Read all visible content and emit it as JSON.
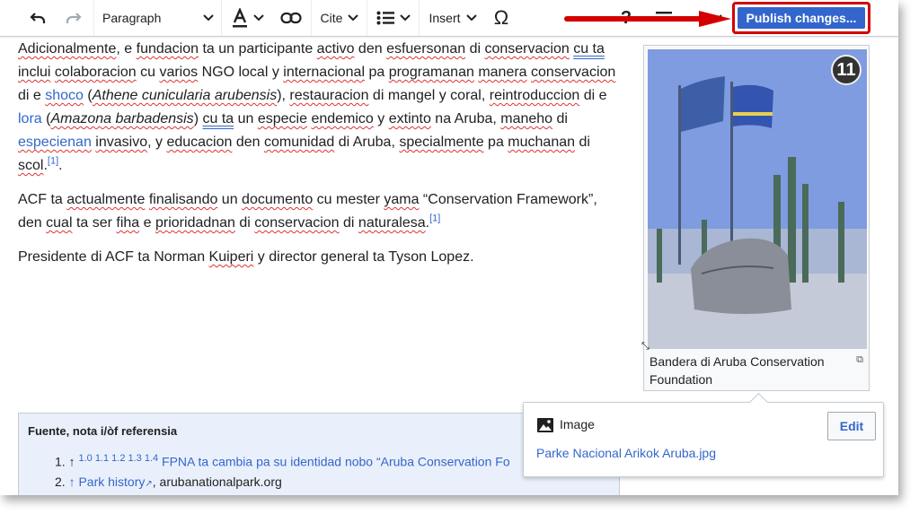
{
  "toolbar": {
    "paragraph_label": "Paragraph",
    "cite_label": "Cite",
    "insert_label": "Insert",
    "publish_label": "Publish changes..."
  },
  "article": {
    "p1": {
      "t1": "Adicionalmente",
      "t2": ", e ",
      "t3": "fundacion",
      "t4": " ta un participante ",
      "t5": "activo",
      "t6": " den ",
      "t7": "esfuersonan",
      "t8": " di ",
      "t9": "conservacion",
      "t10": " ",
      "t11": "cu ta",
      "t12": " ",
      "t13": "inclui",
      "t14": " ",
      "t15": "colaboracion",
      "t16": " cu ",
      "t17": "varios",
      "t18": " NGO local y ",
      "t19": "internacional",
      "t20": " pa ",
      "t21": "programanan",
      "t22": " ",
      "t23": "manera",
      "t24": " ",
      "t25": "conservacion",
      "t26": " di e ",
      "t27": "shoco",
      "t28": " (",
      "t29": "Athene cunicularia arubensis",
      "t30": "), ",
      "t31": "restauracion",
      "t32": " di mangel y coral, ",
      "t33": "reintroduccion",
      "t34": " di e ",
      "t35": "lora",
      "t36": " (",
      "t37": "Amazona barbadensis",
      "t38": ") ",
      "t39": "cu ta",
      "t40": " un ",
      "t41": "especie",
      "t42": " ",
      "t43": "endemico",
      "t44": " y ",
      "t45": "extinto",
      "t46": " na Aruba, ",
      "t47": "maneho",
      "t48": " di ",
      "t49": "especienan",
      "t50": " ",
      "t51": "invasivo",
      "t52": ", y ",
      "t53": "educacion",
      "t54": " den ",
      "t55": "comunidad",
      "t56": " di Aruba, ",
      "t57": "specialmente",
      "t58": " pa ",
      "t59": "muchanan",
      "t60": " di ",
      "t61": "scol",
      "t62": ".",
      "ref": "[1]",
      "t63": "."
    },
    "p2": {
      "t1": "ACF ta ",
      "t2": "actualmente",
      "t3": " ",
      "t4": "finalisando",
      "t5": " un ",
      "t6": "documento",
      "t7": " cu mester ",
      "t8": "yama",
      "t9": " “Conservation Framework”, den ",
      "t10": "cual",
      "t11": " ta ser ",
      "t12": "fiha",
      "t13": " e ",
      "t14": "prioridadnan",
      "t15": " di ",
      "t16": "conservacion",
      "t17": " di ",
      "t18": "naturalesa",
      "t19": ".",
      "ref": "[1]"
    },
    "p3": {
      "t1": "Presidente di ACF ta Norman ",
      "t2": "Kuiperi",
      "t3": " y director general ta Tyson Lopez."
    }
  },
  "thumbnail": {
    "badge": "11",
    "caption": "Bandera di Aruba Conservation Foundation"
  },
  "references": {
    "title": "Fuente, nota i/òf referensia",
    "items": [
      {
        "num": "1.",
        "arrow": "↑",
        "backrefs": "1.0 1.1 1.2 1.3 1.4",
        "text": "FPNA ta cambia pa su identidad nobo “Aruba Conservation Fo"
      },
      {
        "num": "2.",
        "arrow": "↑",
        "link": "Park history",
        "text": ", arubanationalpark.org"
      }
    ]
  },
  "context": {
    "type_label": "Image",
    "edit_label": "Edit",
    "filename": "Parke Nacional Arikok Aruba.jpg"
  },
  "colors": {
    "accent": "#3366cc",
    "annotation": "#d40000"
  }
}
